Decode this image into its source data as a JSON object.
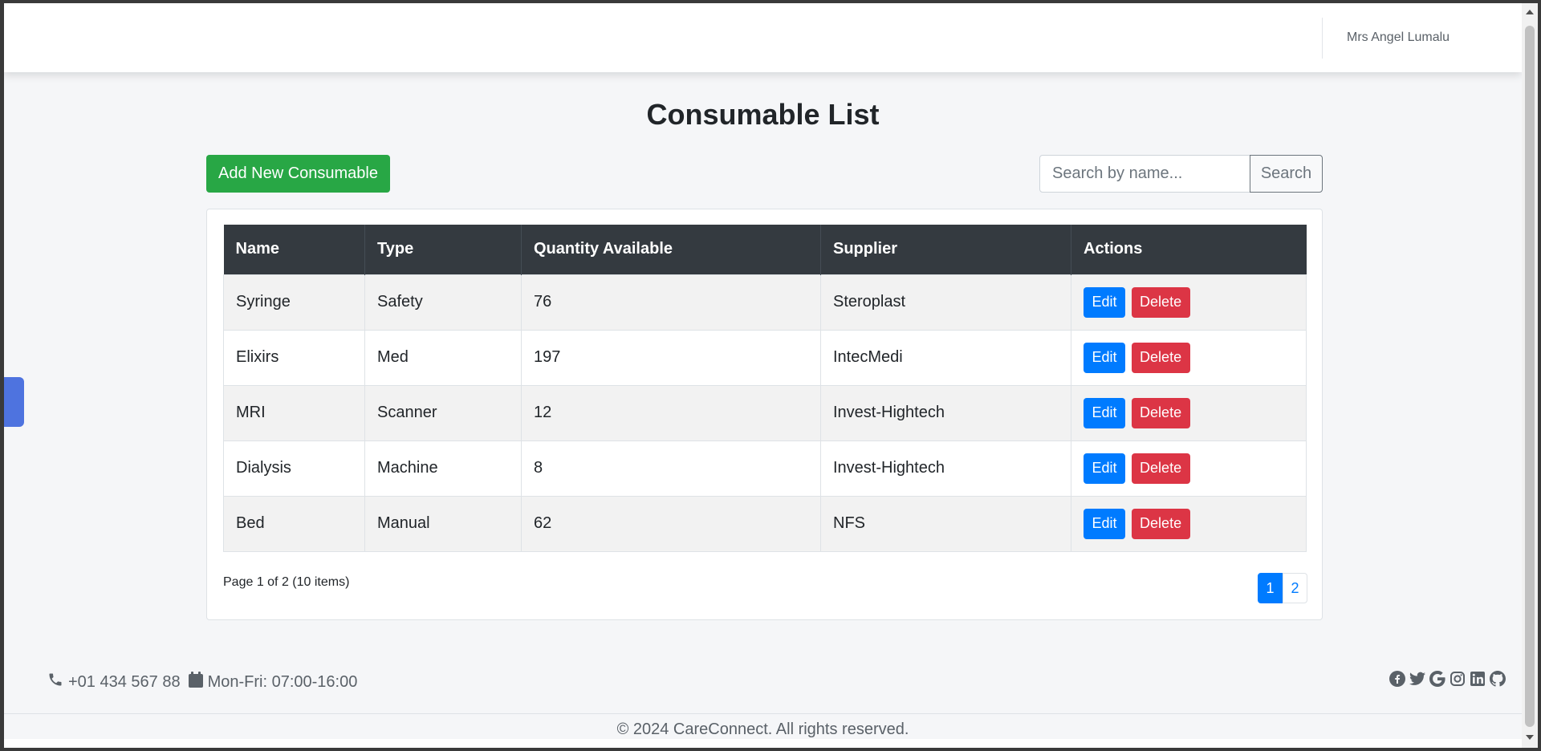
{
  "header": {
    "user_name": "Mrs Angel Lumalu"
  },
  "page": {
    "title": "Consumable List"
  },
  "toolbar": {
    "add_label": "Add New Consumable",
    "search_placeholder": "Search by name...",
    "search_label": "Search"
  },
  "table": {
    "columns": [
      "Name",
      "Type",
      "Quantity Available",
      "Supplier",
      "Actions"
    ],
    "rows": [
      {
        "name": "Syringe",
        "type": "Safety",
        "quantity": "76",
        "supplier": "Steroplast"
      },
      {
        "name": "Elixirs",
        "type": "Med",
        "quantity": "197",
        "supplier": "IntecMedi"
      },
      {
        "name": "MRI",
        "type": "Scanner",
        "quantity": "12",
        "supplier": "Invest-Hightech"
      },
      {
        "name": "Dialysis",
        "type": "Machine",
        "quantity": "8",
        "supplier": "Invest-Hightech"
      },
      {
        "name": "Bed",
        "type": "Manual",
        "quantity": "62",
        "supplier": "NFS"
      }
    ],
    "edit_label": "Edit",
    "delete_label": "Delete"
  },
  "pagination": {
    "info": "Page 1 of 2 (10 items)",
    "pages": [
      "1",
      "2"
    ]
  },
  "footer": {
    "phone": "+01 434 567 88",
    "hours": "Mon-Fri: 07:00-16:00",
    "copyright": "© 2024 CareConnect. All rights reserved.",
    "social_icons": [
      "facebook-icon",
      "twitter-icon",
      "google-icon",
      "instagram-icon",
      "linkedin-icon",
      "github-icon"
    ]
  },
  "colors": {
    "success": "#28a745",
    "primary": "#007bff",
    "danger": "#dc3545",
    "header_dark": "#343a40",
    "side_tab": "#4e73df"
  }
}
